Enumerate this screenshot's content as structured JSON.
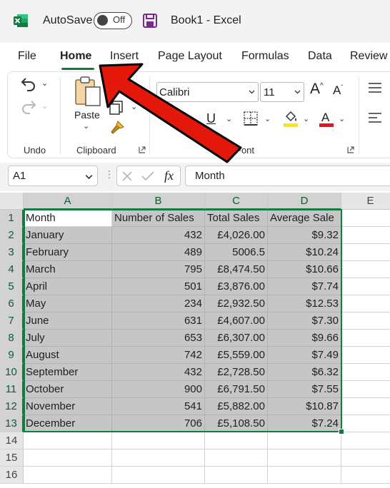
{
  "titlebar": {
    "autosave_label": "AutoSave",
    "autosave_state": "Off",
    "document_title": "Book1  -  Excel"
  },
  "ribbon_tabs": [
    "File",
    "Home",
    "Insert",
    "Page Layout",
    "Formulas",
    "Data",
    "Review"
  ],
  "active_tab": "Home",
  "ribbon": {
    "undo_group_label": "Undo",
    "paste_label": "Paste",
    "clipboard_group_label": "Clipboard",
    "font_group_label": "Font",
    "font_name": "Calibri",
    "font_size": "11",
    "underline_label": "U",
    "font_color": "#e81123",
    "highlight_color": "#ffe600"
  },
  "formula_bar": {
    "name_box": "A1",
    "fx_label": "fx",
    "formula_value": "Month"
  },
  "sheet": {
    "columns": [
      "A",
      "B",
      "C",
      "D",
      "E"
    ],
    "selected_columns": [
      "A",
      "B",
      "C",
      "D"
    ],
    "row_numbers": [
      "1",
      "2",
      "3",
      "4",
      "5",
      "6",
      "7",
      "8",
      "9",
      "10",
      "11",
      "12",
      "13",
      "14",
      "15",
      "16"
    ],
    "rows": [
      [
        "Month",
        "Number of Sales",
        "Total Sales",
        "Average Sale"
      ],
      [
        "January",
        "432",
        "£4,026.00",
        "$9.32"
      ],
      [
        "February",
        "489",
        "5006.5",
        "$10.24"
      ],
      [
        "March",
        "795",
        "£8,474.50",
        "$10.66"
      ],
      [
        "April",
        "501",
        "£3,876.00",
        "$7.74"
      ],
      [
        "May",
        "234",
        "£2,932.50",
        "$12.53"
      ],
      [
        "June",
        "631",
        "£4,607.00",
        "$7.30"
      ],
      [
        "July",
        "653",
        "£6,307.00",
        "$9.66"
      ],
      [
        "August",
        "742",
        "£5,559.00",
        "$7.49"
      ],
      [
        "September",
        "432",
        "£2,728.50",
        "$6.32"
      ],
      [
        "October",
        "900",
        "£6,791.50",
        "$7.55"
      ],
      [
        "November",
        "541",
        "£5,882.00",
        "$10.87"
      ],
      [
        "December",
        "706",
        "£5,108.50",
        "$7.24"
      ]
    ]
  },
  "colors": {
    "excel_green": "#107c41",
    "arrow_red": "#e3170a",
    "selection_gray": "#c6c6c6"
  }
}
